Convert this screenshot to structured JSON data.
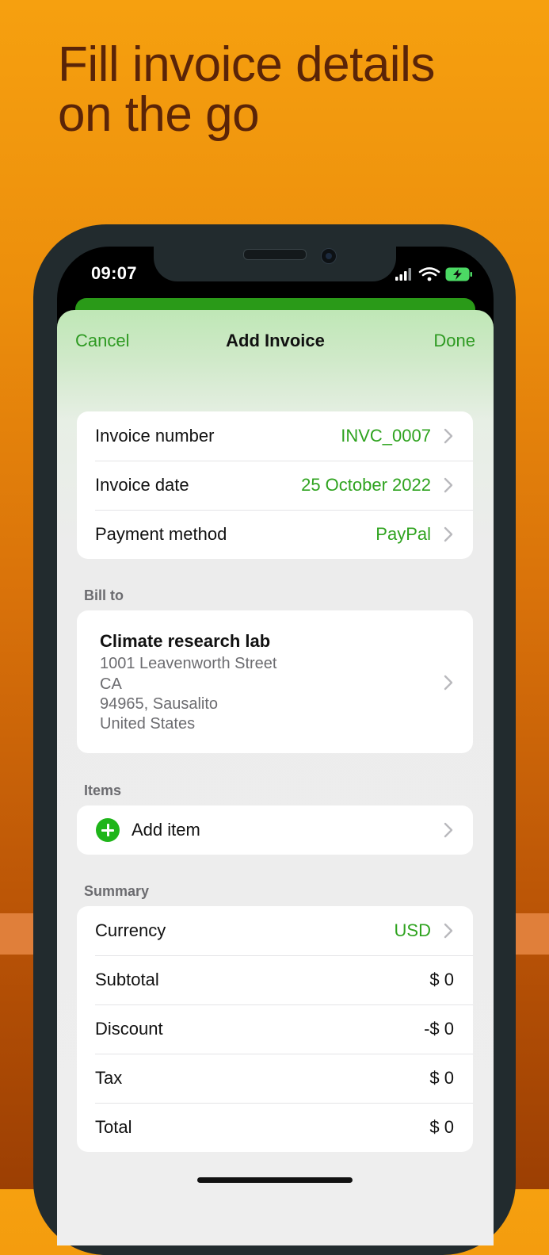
{
  "promo": {
    "headline_line1": "Fill invoice details",
    "headline_line2": "on the go"
  },
  "status_bar": {
    "time": "09:07",
    "icons": [
      "cellular-signal-icon",
      "wifi-icon",
      "battery-charging-icon"
    ]
  },
  "nav": {
    "cancel_label": "Cancel",
    "title": "Add Invoice",
    "done_label": "Done"
  },
  "invoice_details": [
    {
      "label": "Invoice number",
      "value": "INVC_0007"
    },
    {
      "label": "Invoice date",
      "value": "25 October 2022"
    },
    {
      "label": "Payment method",
      "value": "PayPal"
    }
  ],
  "bill_to": {
    "section_label": "Bill to",
    "name": "Climate research lab",
    "address_lines": [
      "1001  Leavenworth Street",
      "CA",
      "94965, Sausalito",
      "United States"
    ]
  },
  "items": {
    "section_label": "Items",
    "add_label": "Add item"
  },
  "summary": {
    "section_label": "Summary",
    "currency": {
      "label": "Currency",
      "value": "USD"
    },
    "rows": [
      {
        "label": "Subtotal",
        "value": "$ 0"
      },
      {
        "label": "Discount",
        "value": "-$ 0"
      },
      {
        "label": "Tax",
        "value": "$ 0"
      },
      {
        "label": "Total",
        "value": "$ 0"
      }
    ]
  },
  "colors": {
    "accent_green": "#2e9a22",
    "value_green": "#2fa31f",
    "add_button_green": "#1fb51a",
    "headline_brown": "#5a2408",
    "background_orange": "#ec8e0c"
  }
}
